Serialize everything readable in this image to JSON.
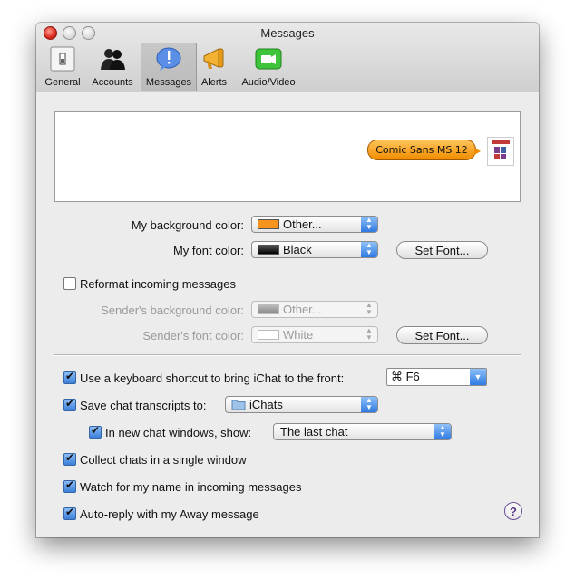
{
  "window": {
    "title": "Messages"
  },
  "toolbar": {
    "items": [
      {
        "label": "General",
        "icon": "switch-icon"
      },
      {
        "label": "Accounts",
        "icon": "people-icon"
      },
      {
        "label": "Messages",
        "icon": "speech-bubble-icon",
        "selected": true
      },
      {
        "label": "Alerts",
        "icon": "megaphone-icon"
      },
      {
        "label": "Audio/Video",
        "icon": "camera-icon"
      }
    ]
  },
  "preview": {
    "bubble_text": "Comic Sans MS 12"
  },
  "appearance": {
    "bg_color_label": "My background color:",
    "bg_color_value": "Other...",
    "bg_color_swatch": "#f7941d",
    "font_color_label": "My font color:",
    "font_color_value": "Black",
    "font_color_swatch": "#000000",
    "set_font_label": "Set Font...",
    "reformat_label": "Reformat incoming messages",
    "sender_bg_label": "Sender's background color:",
    "sender_bg_value": "Other...",
    "sender_font_label": "Sender's font color:",
    "sender_font_value": "White",
    "sender_set_font_label": "Set Font..."
  },
  "options": {
    "shortcut_label": "Use a keyboard shortcut to bring iChat to the front:",
    "shortcut_value": "⌘ F6",
    "transcripts_label": "Save chat transcripts to:",
    "transcripts_value": "iChats",
    "new_chat_label": "In new chat windows, show:",
    "new_chat_value": "The last chat",
    "collect_label": "Collect chats in a single window",
    "watch_label": "Watch for my name in incoming messages",
    "autoreply_label": "Auto-reply with my Away message",
    "help_label": "?"
  }
}
